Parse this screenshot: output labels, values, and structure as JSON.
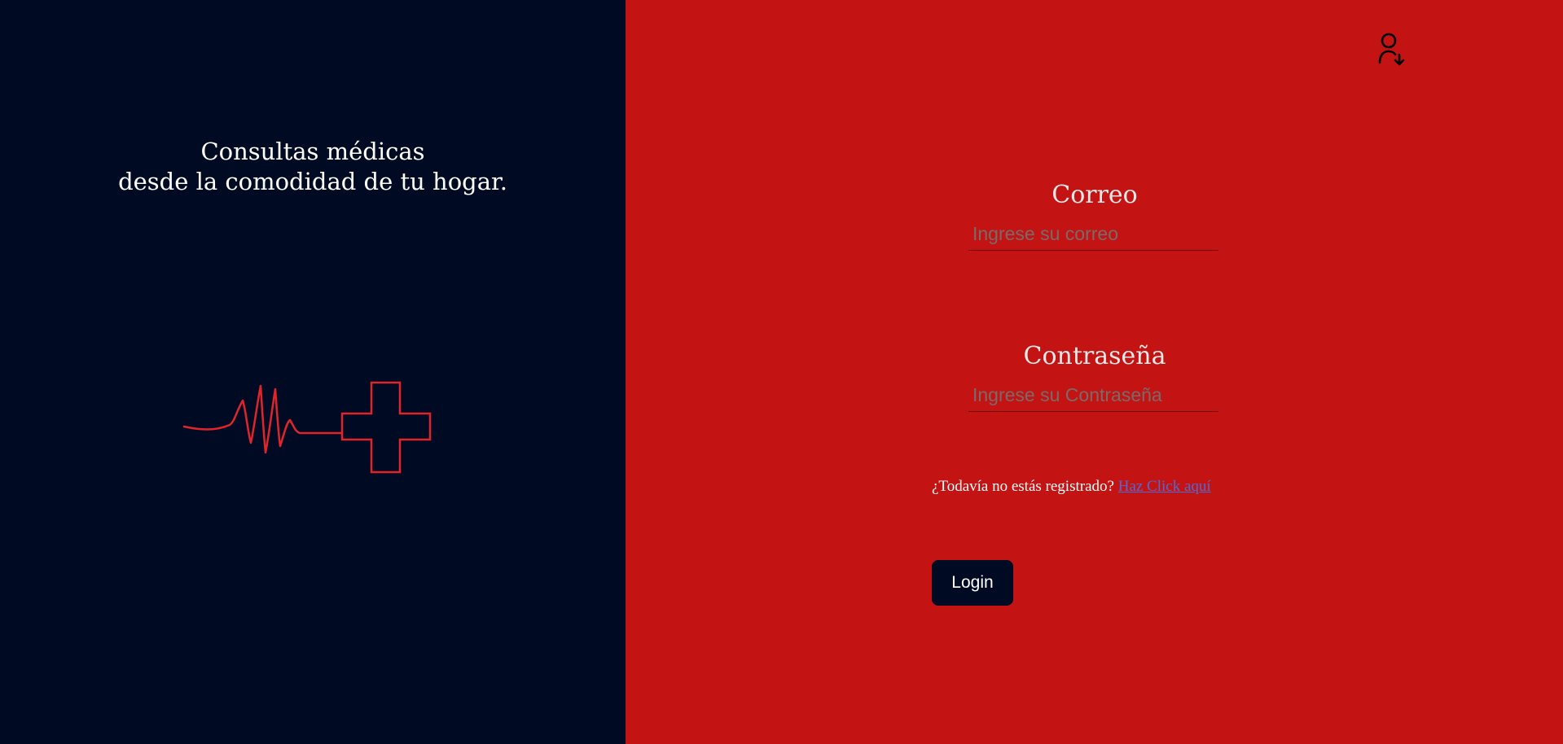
{
  "left": {
    "tagline_line1": "Consultas médicas",
    "tagline_line2": "desde la comodidad de tu hogar.",
    "logo_icon": "heartbeat-cross-icon",
    "accent_color": "#e0242a"
  },
  "right": {
    "user_icon": "user-download-icon",
    "email": {
      "label": "Correo",
      "placeholder": "Ingrese su correo",
      "value": ""
    },
    "password": {
      "label": "Contraseña",
      "placeholder": "Ingrese su Contraseña",
      "value": ""
    },
    "register": {
      "prompt": "¿Todavía no estás registrado?",
      "link_text": "Haz Click aquí"
    },
    "login_label": "Login"
  },
  "colors": {
    "left_background": "#000b23",
    "right_background": "#c31313",
    "link": "#4d6bd6"
  }
}
